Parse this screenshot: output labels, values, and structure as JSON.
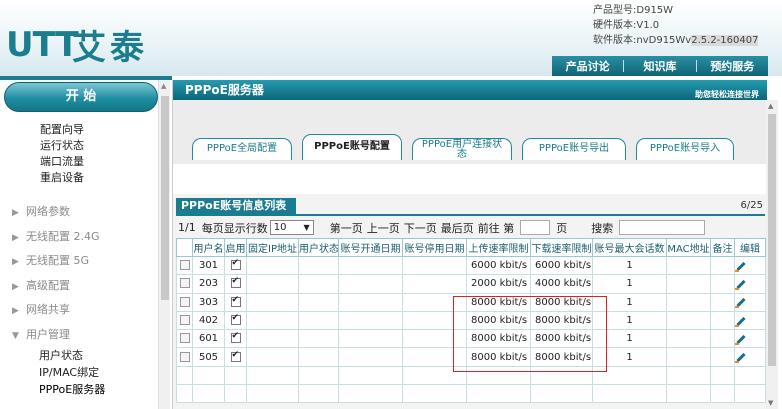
{
  "brand": {
    "latin": "UTT",
    "chinese": "艾泰"
  },
  "product_info": [
    {
      "label": "产品型号:",
      "value": "D915W"
    },
    {
      "label": "硬件版本:",
      "value": "V1.0"
    },
    {
      "label": "软件版本:",
      "value": "nvD915Wv",
      "highlight": "2.5.2-160407"
    }
  ],
  "top_nav": [
    "产品讨论",
    "知识库",
    "预约服务"
  ],
  "sidebar": {
    "start": "开 始",
    "quick": [
      "配置向导",
      "运行状态",
      "端口流量",
      "重启设备"
    ],
    "groups": [
      {
        "label": "网络参数",
        "arrow": "▶"
      },
      {
        "label": "无线配置 2.4G",
        "arrow": "▶"
      },
      {
        "label": "无线配置 5G",
        "arrow": "▶"
      },
      {
        "label": "高级配置",
        "arrow": "▶"
      },
      {
        "label": "网络共享",
        "arrow": "▶"
      },
      {
        "label": "用户管理",
        "arrow": "▼"
      }
    ],
    "sub_items": [
      "用户状态",
      "IP/MAC绑定",
      "PPPoE服务器"
    ]
  },
  "main": {
    "title": "PPPoE服务器",
    "help": "助您轻松连接世界",
    "tabs": [
      {
        "label": "PPPoE全局配置",
        "active": false
      },
      {
        "label": "PPPoE账号配置",
        "active": true
      },
      {
        "label": "PPPoE用户连接状态",
        "active": false
      },
      {
        "label": "PPPoE账号导出",
        "active": false
      },
      {
        "label": "PPPoE账号导入",
        "active": false
      }
    ],
    "list_title": "PPPoE账号信息列表",
    "count": "6/25",
    "pager": {
      "page": "1/1",
      "per_page_label": "每页显示行数",
      "per_page_value": "10",
      "first": "第一页",
      "prev": "上一页",
      "next": "下一页",
      "last": "最后页",
      "goto_prefix": "前往 第",
      "goto_suffix": "页",
      "search_label": "搜索"
    },
    "columns": [
      "用户名",
      "启用",
      "固定IP地址",
      "用户状态",
      "账号开通日期",
      "账号停用日期",
      "上传速率限制",
      "下载速率限制",
      "账号最大会话数",
      "MAC地址",
      "备注",
      "编辑"
    ],
    "rows": [
      {
        "user": "301",
        "enabled": true,
        "up": "6000 kbit/s",
        "down": "6000 kbit/s",
        "sessions": "1"
      },
      {
        "user": "203",
        "enabled": true,
        "up": "2000 kbit/s",
        "down": "4000 kbit/s",
        "sessions": "1"
      },
      {
        "user": "303",
        "enabled": true,
        "up": "8000 kbit/s",
        "down": "8000 kbit/s",
        "sessions": "1"
      },
      {
        "user": "402",
        "enabled": true,
        "up": "8000 kbit/s",
        "down": "8000 kbit/s",
        "sessions": "1"
      },
      {
        "user": "601",
        "enabled": true,
        "up": "8000 kbit/s",
        "down": "8000 kbit/s",
        "sessions": "1"
      },
      {
        "user": "505",
        "enabled": true,
        "up": "8000 kbit/s",
        "down": "8000 kbit/s",
        "sessions": "1"
      }
    ],
    "empty_rows": 2
  },
  "colors": {
    "accent": "#1b7c8f",
    "highlight_box": "#e02020"
  }
}
